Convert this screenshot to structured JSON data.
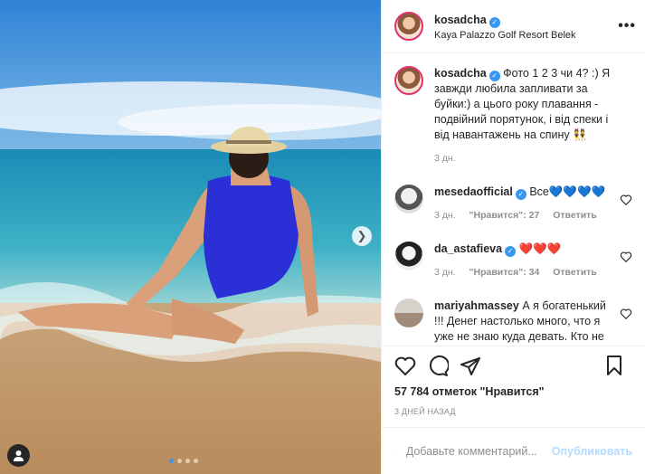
{
  "header": {
    "username": "kosadcha",
    "location": "Kaya Palazzo Golf Resort Belek",
    "more_label": "•••"
  },
  "caption": {
    "username": "kosadcha",
    "text": "Фото 1 2 3 чи 4? :) Я завжди любила запливати за буйки:) а цього року плавання - подвійний порятунок, і від спеки і від навантажень на спину 👯",
    "time": "3 дн."
  },
  "comments": [
    {
      "username": "mesedaofficial",
      "text": "Все💙💙💙💙",
      "time": "3 дн.",
      "likes": "\"Нравится\": 27",
      "reply": "Ответить",
      "avatar_color": "#d9d9d9"
    },
    {
      "username": "da_astafieva",
      "text": "❤️❤️❤️",
      "time": "3 дн.",
      "likes": "\"Нравится\": 34",
      "reply": "Ответить",
      "avatar_color": "#bdbdbd"
    },
    {
      "username": "mariyahmassey",
      "text": "А я богатенький !!! Денег настолько много, что я уже не знаю куда девать. Кто не против что бы я закинул",
      "time": "",
      "likes": "",
      "reply": "",
      "avatar_color": "#c9b8a8"
    }
  ],
  "likes_count": "57 784 отметок \"Нравится\"",
  "posted_ago": "3 ДНЕЙ НАЗАД",
  "add_comment": {
    "placeholder": "Добавьте комментарий...",
    "publish_label": "Опубликовать"
  },
  "carousel": {
    "total": 4,
    "current": 1
  },
  "colors": {
    "accent": "#3897f0",
    "sky": "#3a8fd8",
    "sea": "#2f9fb8",
    "sand": "#c9a47a",
    "swimsuit": "#2a2fd6"
  }
}
